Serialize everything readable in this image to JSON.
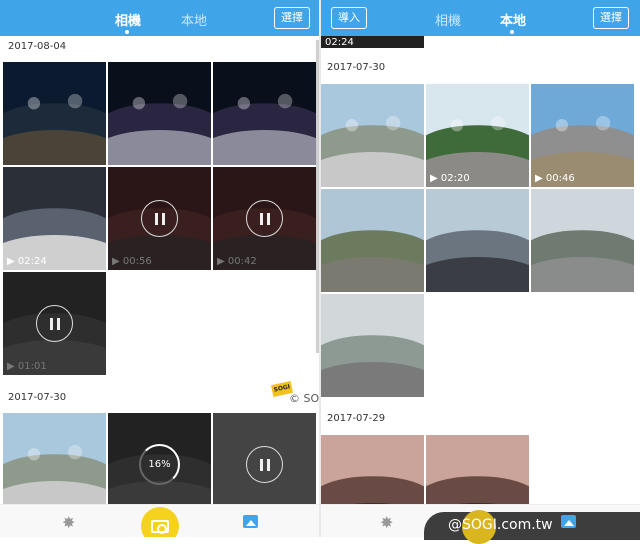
{
  "left": {
    "tabs": [
      "相機",
      "本地"
    ],
    "select_label": "選擇",
    "groups": [
      {
        "date": "2017-08-04",
        "items": [
          {
            "duration": "",
            "state": "photo",
            "scene": "night-building"
          },
          {
            "duration": "",
            "state": "photo",
            "scene": "night-trees"
          },
          {
            "duration": "",
            "state": "photo",
            "scene": "night-trees"
          },
          {
            "duration": "02:24",
            "state": "video",
            "scene": "indoor-selfie"
          },
          {
            "duration": "00:56",
            "state": "paused",
            "scene": "dark-red"
          },
          {
            "duration": "00:42",
            "state": "paused",
            "scene": "dark-red"
          },
          {
            "duration": "01:01",
            "state": "paused",
            "scene": "dark-gray"
          }
        ]
      },
      {
        "date": "2017-07-30",
        "items": [
          {
            "duration": "",
            "state": "photo",
            "scene": "plaza-day"
          },
          {
            "duration": "",
            "state": "downloading",
            "progress": "16%",
            "scene": "dark-gray"
          },
          {
            "duration": "",
            "state": "paused",
            "scene": "blank-dark"
          }
        ]
      }
    ]
  },
  "right": {
    "import_label": "導入",
    "tabs": [
      "相機",
      "本地"
    ],
    "select_label": "選擇",
    "top_partial_duration": "02:24",
    "groups": [
      {
        "date": "2017-07-30",
        "items": [
          {
            "duration": "",
            "scene": "plaza-day"
          },
          {
            "duration": "02:20",
            "scene": "tree-plaza"
          },
          {
            "duration": "00:46",
            "scene": "building-sky"
          },
          {
            "duration": "",
            "scene": "stadium-green"
          },
          {
            "duration": "",
            "scene": "dome-road"
          },
          {
            "duration": "",
            "scene": "canopy-person"
          },
          {
            "duration": "",
            "scene": "canopy-interior"
          }
        ]
      },
      {
        "date": "2017-07-29",
        "items": [
          {
            "duration": "",
            "scene": "restaurant"
          },
          {
            "duration": "",
            "scene": "restaurant"
          }
        ]
      }
    ]
  },
  "watermarks": {
    "center": "© SOGI.com.tw",
    "corner": "@SOGI.com.tw",
    "badge": "SOGI"
  },
  "colors": {
    "accent": "#3fa5e8",
    "camera_button": "#f5d21e"
  }
}
